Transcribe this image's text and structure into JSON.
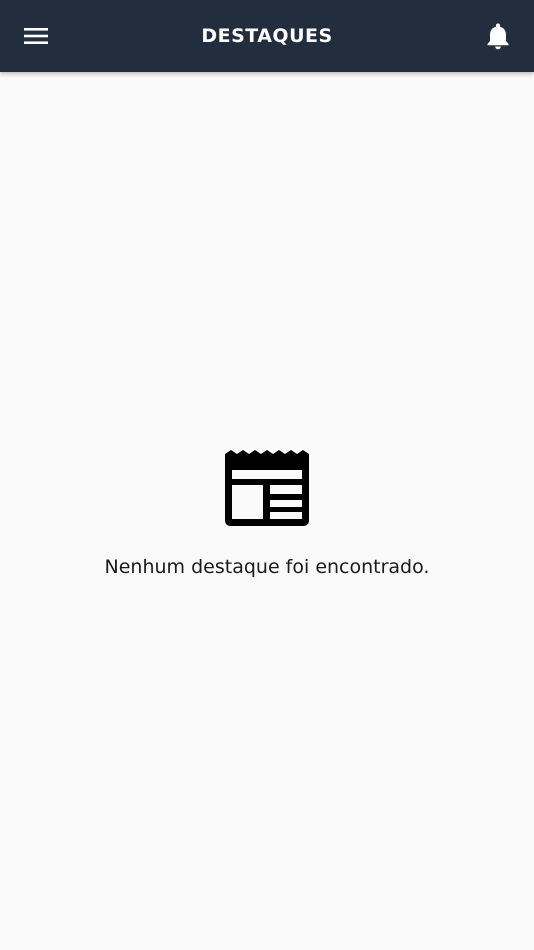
{
  "header": {
    "title": "DESTAQUES",
    "menu_icon": "hamburger-menu-icon",
    "notification_icon": "bell-icon",
    "background": "#222e3d"
  },
  "main": {
    "empty_icon": "newspaper-icon",
    "empty_message": "Nenhum destaque foi encontrado."
  }
}
